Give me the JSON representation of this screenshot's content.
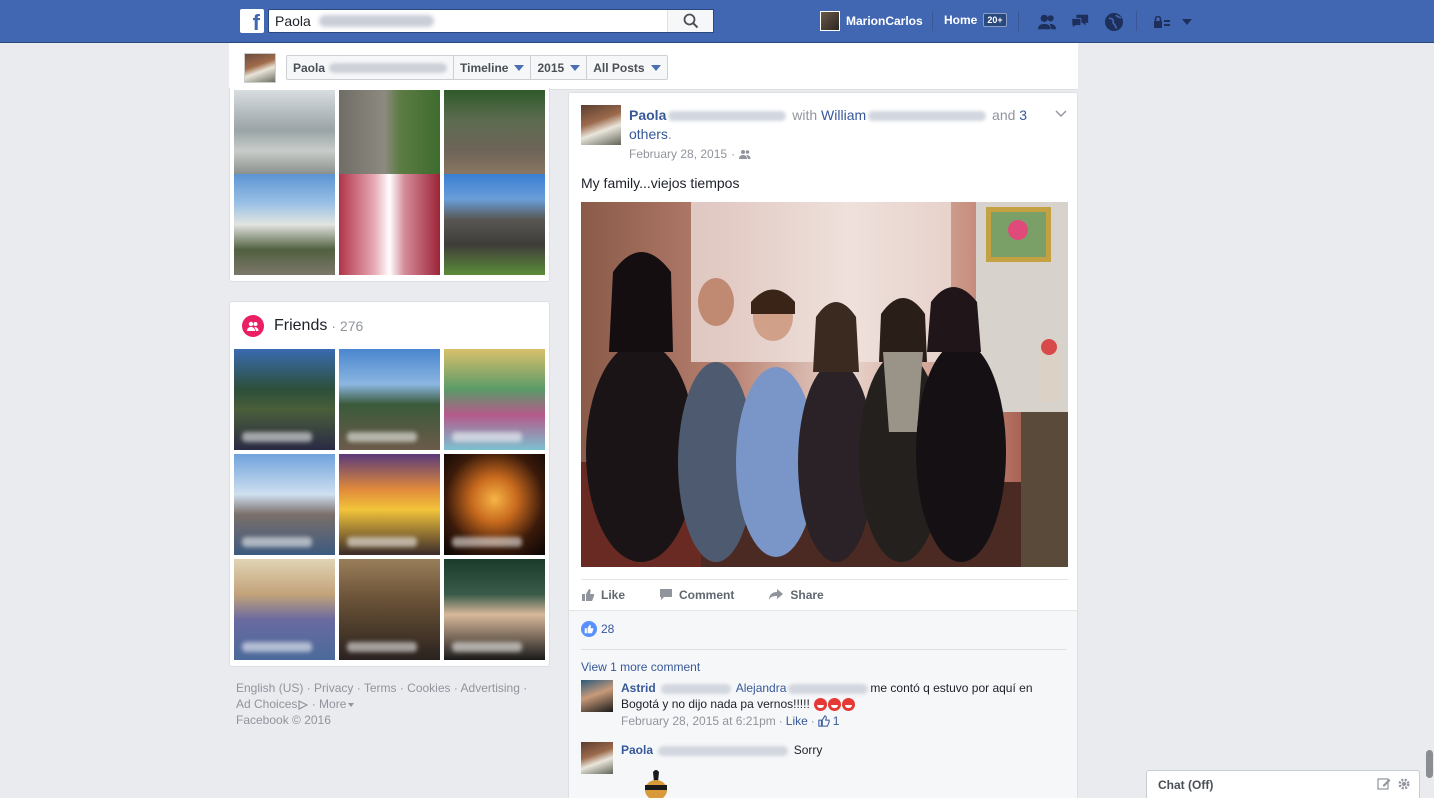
{
  "topbar": {
    "search_value": "Paola",
    "user_name": "MarionCarlos",
    "home_label": "Home",
    "home_badge": "20+"
  },
  "sticky": {
    "profile_name": "Paola",
    "timeline_label": "Timeline",
    "year_label": "2015",
    "filter_label": "All Posts"
  },
  "friends": {
    "title": "Friends",
    "count": "276"
  },
  "footer": {
    "links": [
      "English (US)",
      "Privacy",
      "Terms",
      "Cookies",
      "Advertising",
      "Ad Choices",
      "More"
    ],
    "copyright": "Facebook © 2016"
  },
  "post": {
    "author": "Paola",
    "with_text": "with",
    "tagged": "William",
    "and_text": "and",
    "others": "3 others",
    "date": "February 28, 2015",
    "text": "My family...viejos tiempos",
    "like_label": "Like",
    "comment_label": "Comment",
    "share_label": "Share",
    "like_count": "28",
    "view_more": "View 1 more comment"
  },
  "comments": [
    {
      "author": "Astrid",
      "mention": "Alejandra",
      "text": "me contó q estuvo por aquí en Bogotá y no dijo nada pa vernos!!!!!",
      "date": "February 28, 2015 at 6:21pm",
      "like_label": "Like",
      "like_count": "1"
    },
    {
      "author": "Paola",
      "text": "Sorry"
    }
  ],
  "chat": {
    "label": "Chat (Off)"
  }
}
